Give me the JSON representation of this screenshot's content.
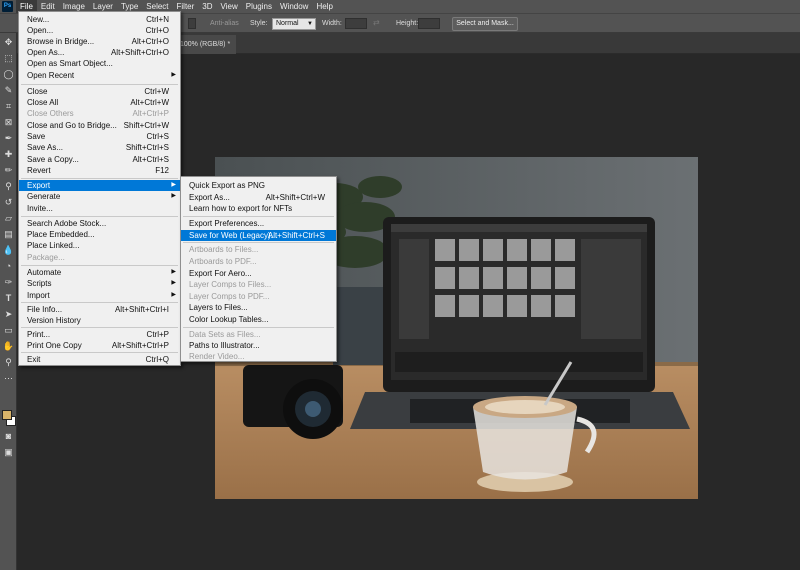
{
  "menubar": {
    "logo": "Ps",
    "items": [
      "File",
      "Edit",
      "Image",
      "Layer",
      "Type",
      "Select",
      "Filter",
      "3D",
      "View",
      "Plugins",
      "Window",
      "Help"
    ]
  },
  "options": {
    "anti_alias": "Anti-alias",
    "style_label": "Style:",
    "style_value": "Normal",
    "width_label": "Width:",
    "height_label": "Height:",
    "select_mask": "Select and Mask..."
  },
  "document": {
    "tab_title": "100% (RGB/8) *",
    "close": "×"
  },
  "colors": {
    "highlight": "#0078d7",
    "foreground": "#d8b46a",
    "background": "#ffffff"
  },
  "file_menu": [
    {
      "label": "New...",
      "sc": "Ctrl+N"
    },
    {
      "label": "Open...",
      "sc": "Ctrl+O"
    },
    {
      "label": "Browse in Bridge...",
      "sc": "Alt+Ctrl+O"
    },
    {
      "label": "Open As...",
      "sc": "Alt+Shift+Ctrl+O"
    },
    {
      "label": "Open as Smart Object...",
      "sc": ""
    },
    {
      "label": "Open Recent",
      "sc": "",
      "arrow": "▶"
    },
    {
      "label": "Close",
      "sc": "Ctrl+W"
    },
    {
      "label": "Close All",
      "sc": "Alt+Ctrl+W"
    },
    {
      "label": "Close Others",
      "sc": "Alt+Ctrl+P"
    },
    {
      "label": "Close and Go to Bridge...",
      "sc": "Shift+Ctrl+W"
    },
    {
      "label": "Save",
      "sc": "Ctrl+S"
    },
    {
      "label": "Save As...",
      "sc": "Shift+Ctrl+S"
    },
    {
      "label": "Save a Copy...",
      "sc": "Alt+Ctrl+S"
    },
    {
      "label": "Revert",
      "sc": "F12"
    },
    {
      "label": "Export",
      "sc": "",
      "arrow": "▶"
    },
    {
      "label": "Generate",
      "sc": "",
      "arrow": "▶"
    },
    {
      "label": "Invite...",
      "sc": ""
    },
    {
      "label": "Search Adobe Stock...",
      "sc": ""
    },
    {
      "label": "Place Embedded...",
      "sc": ""
    },
    {
      "label": "Place Linked...",
      "sc": ""
    },
    {
      "label": "Package...",
      "sc": ""
    },
    {
      "label": "Automate",
      "sc": "",
      "arrow": "▶"
    },
    {
      "label": "Scripts",
      "sc": "",
      "arrow": "▶"
    },
    {
      "label": "Import",
      "sc": "",
      "arrow": "▶"
    },
    {
      "label": "File Info...",
      "sc": "Alt+Shift+Ctrl+I"
    },
    {
      "label": "Version History",
      "sc": ""
    },
    {
      "label": "Print...",
      "sc": "Ctrl+P"
    },
    {
      "label": "Print One Copy",
      "sc": "Alt+Shift+Ctrl+P"
    },
    {
      "label": "Exit",
      "sc": "Ctrl+Q"
    }
  ],
  "export_menu": [
    {
      "label": "Quick Export as PNG",
      "sc": ""
    },
    {
      "label": "Export As...",
      "sc": "Alt+Shift+Ctrl+W"
    },
    {
      "label": "Learn how to export for NFTs",
      "sc": ""
    },
    {
      "label": "Export Preferences...",
      "sc": ""
    },
    {
      "label": "Save for Web (Legacy)...",
      "sc": "Alt+Shift+Ctrl+S"
    },
    {
      "label": "Artboards to Files...",
      "sc": ""
    },
    {
      "label": "Artboards to PDF...",
      "sc": ""
    },
    {
      "label": "Export For Aero...",
      "sc": ""
    },
    {
      "label": "Layer Comps to Files...",
      "sc": ""
    },
    {
      "label": "Layer Comps to PDF...",
      "sc": ""
    },
    {
      "label": "Layers to Files...",
      "sc": ""
    },
    {
      "label": "Color Lookup Tables...",
      "sc": ""
    },
    {
      "label": "Data Sets as Files...",
      "sc": ""
    },
    {
      "label": "Paths to Illustrator...",
      "sc": ""
    },
    {
      "label": "Render Video...",
      "sc": ""
    }
  ]
}
